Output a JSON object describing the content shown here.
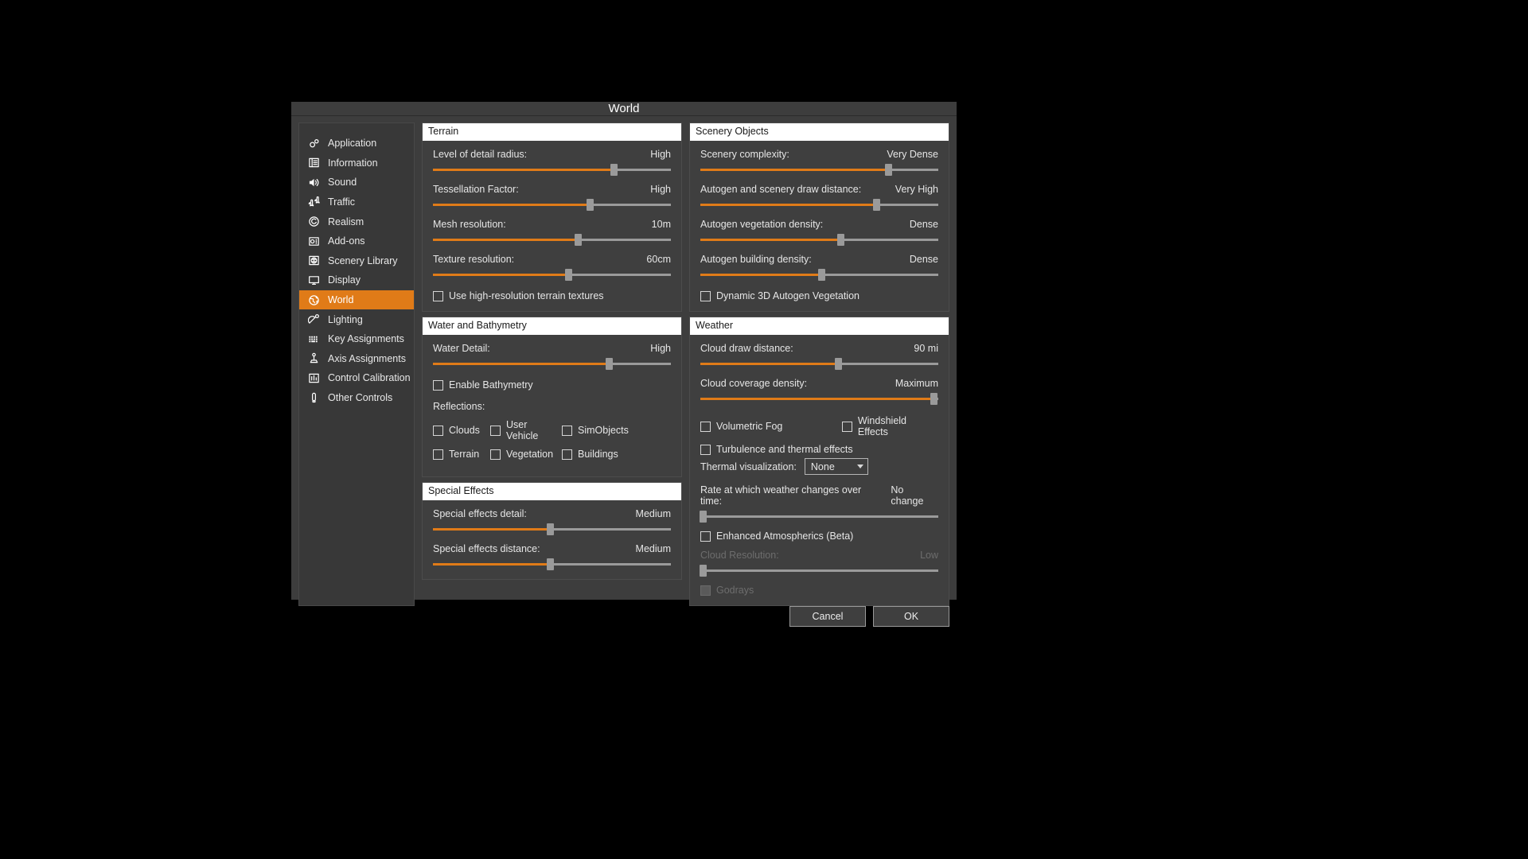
{
  "window": {
    "title": "World"
  },
  "sidebar": {
    "items": [
      {
        "label": "Application",
        "icon": "gears-icon",
        "active": false
      },
      {
        "label": "Information",
        "icon": "list-icon",
        "active": false
      },
      {
        "label": "Sound",
        "icon": "speaker-icon",
        "active": false
      },
      {
        "label": "Traffic",
        "icon": "aircraft-traffic-icon",
        "active": false
      },
      {
        "label": "Realism",
        "icon": "gauge-icon",
        "active": false
      },
      {
        "label": "Add-ons",
        "icon": "module-icon",
        "active": false
      },
      {
        "label": "Scenery Library",
        "icon": "globe-library-icon",
        "active": false
      },
      {
        "label": "Display",
        "icon": "monitor-icon",
        "active": false
      },
      {
        "label": "World",
        "icon": "globe-icon",
        "active": true
      },
      {
        "label": "Lighting",
        "icon": "lighting-icon",
        "active": false
      },
      {
        "label": "Key Assignments",
        "icon": "keyboard-icon",
        "active": false
      },
      {
        "label": "Axis Assignments",
        "icon": "joystick-icon",
        "active": false
      },
      {
        "label": "Control Calibration",
        "icon": "calibration-icon",
        "active": false
      },
      {
        "label": "Other Controls",
        "icon": "controls-icon",
        "active": false
      }
    ]
  },
  "terrain": {
    "title": "Terrain",
    "sliders": [
      {
        "label": "Level of detail radius:",
        "value": "High",
        "pct": 76
      },
      {
        "label": "Tessellation Factor:",
        "value": "High",
        "pct": 66
      },
      {
        "label": "Mesh resolution:",
        "value": "10m",
        "pct": 61
      },
      {
        "label": "Texture resolution:",
        "value": "60cm",
        "pct": 57
      }
    ],
    "checkbox": {
      "label": "Use high-resolution terrain textures",
      "checked": false
    }
  },
  "water": {
    "title": "Water and Bathymetry",
    "sliders": [
      {
        "label": "Water Detail:",
        "value": "High",
        "pct": 74
      }
    ],
    "bathymetry": {
      "label": "Enable Bathymetry",
      "checked": false
    },
    "reflections_label": "Reflections:",
    "reflections": [
      {
        "label": "Clouds",
        "checked": false
      },
      {
        "label": "User Vehicle",
        "checked": false
      },
      {
        "label": "SimObjects",
        "checked": false
      },
      {
        "label": "Terrain",
        "checked": false
      },
      {
        "label": "Vegetation",
        "checked": false
      },
      {
        "label": "Buildings",
        "checked": false
      }
    ]
  },
  "special_effects": {
    "title": "Special Effects",
    "sliders": [
      {
        "label": "Special effects detail:",
        "value": "Medium",
        "pct": 49
      },
      {
        "label": "Special effects distance:",
        "value": "Medium",
        "pct": 49
      }
    ]
  },
  "scenery": {
    "title": "Scenery Objects",
    "sliders": [
      {
        "label": "Scenery complexity:",
        "value": "Very Dense",
        "pct": 79
      },
      {
        "label": "Autogen and scenery draw distance:",
        "value": "Very High",
        "pct": 74
      },
      {
        "label": "Autogen vegetation density:",
        "value": "Dense",
        "pct": 59
      },
      {
        "label": "Autogen building density:",
        "value": "Dense",
        "pct": 51
      }
    ],
    "checkbox": {
      "label": "Dynamic 3D Autogen Vegetation",
      "checked": false
    }
  },
  "weather": {
    "title": "Weather",
    "sliders": [
      {
        "label": "Cloud draw distance:",
        "value": "90 mi",
        "pct": 58
      },
      {
        "label": "Cloud coverage density:",
        "value": "Maximum",
        "pct": 98
      }
    ],
    "checkboxes": [
      {
        "label": "Volumetric Fog",
        "checked": false
      },
      {
        "label": "Windshield Effects",
        "checked": false
      },
      {
        "label": "Turbulence and thermal effects",
        "checked": false
      }
    ],
    "thermal": {
      "label": "Thermal visualization:",
      "value": "None"
    },
    "rate": {
      "label": "Rate at which weather changes over time:",
      "value": "No change",
      "pct": 1
    },
    "enhanced": {
      "label": "Enhanced Atmospherics (Beta)",
      "checked": false
    },
    "cloud_resolution": {
      "label": "Cloud Resolution:",
      "value": "Low",
      "pct": 1,
      "disabled": true
    },
    "godrays": {
      "label": "Godrays",
      "checked": false,
      "disabled": true
    }
  },
  "footer": {
    "cancel": "Cancel",
    "ok": "OK"
  },
  "colors": {
    "accent": "#e07b18",
    "panel": "#3f3f3f",
    "dialog": "#3d3d3d"
  }
}
